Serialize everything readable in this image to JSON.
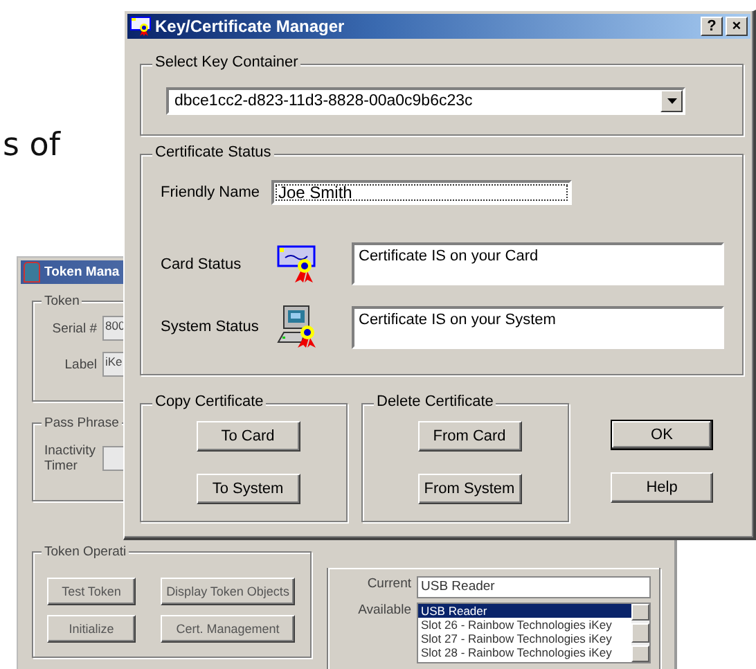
{
  "slide_text": "s of",
  "back_window": {
    "title": "Token Mana",
    "token_group": {
      "title": "Token",
      "fields": [
        {
          "label": "Serial #",
          "value": "800"
        },
        {
          "label": "Label",
          "value": "iKe"
        }
      ]
    },
    "pass_phrase_group": {
      "title": "Pass Phrase",
      "timer_label": "Inactivity Timer"
    },
    "operations_group": {
      "title": "Token Operati",
      "buttons": [
        "Test Token",
        "Display Token Objects",
        "Initialize",
        "Cert. Management"
      ]
    },
    "reader_group": {
      "current_label": "Current",
      "current_value": "USB Reader",
      "available_label": "Available",
      "items": [
        {
          "label": "USB Reader",
          "selected": true
        },
        {
          "label": "Slot 26 - Rainbow Technologies iKey",
          "selected": false
        },
        {
          "label": "Slot 27 - Rainbow Technologies iKey",
          "selected": false
        },
        {
          "label": "Slot 28 - Rainbow Technologies iKey",
          "selected": false
        }
      ]
    }
  },
  "front_window": {
    "title": "Key/Certificate Manager",
    "help_button": "?",
    "close_button": "×",
    "key_container": {
      "title": "Select Key Container",
      "value": "dbce1cc2-d823-11d3-8828-00a0c9b6c23c"
    },
    "certificate_status": {
      "title": "Certificate Status",
      "friendly_name_label": "Friendly Name",
      "friendly_name": "Joe Smith",
      "rows": [
        {
          "label": "Card Status",
          "kind": "card",
          "text": "Certificate IS on your Card"
        },
        {
          "label": "System Status",
          "kind": "system",
          "text": "Certificate IS on your System"
        }
      ]
    },
    "copy_group": {
      "title": "Copy Certificate",
      "buttons": [
        "To Card",
        "To System"
      ]
    },
    "delete_group": {
      "title": "Delete Certificate",
      "buttons": [
        "From Card",
        "From System"
      ]
    },
    "buttons": [
      {
        "label": "OK",
        "default": true
      },
      {
        "label": "Help",
        "default": false
      }
    ]
  }
}
